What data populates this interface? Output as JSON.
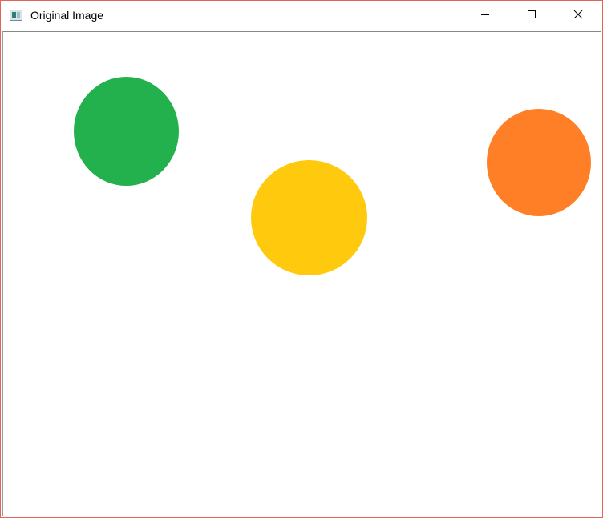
{
  "window": {
    "title": "Original Image",
    "border_color": "#e0645a"
  },
  "titlebar": {
    "icon": "app-window-icon",
    "controls": [
      "minimize-icon",
      "maximize-icon",
      "close-icon"
    ]
  },
  "canvas": {
    "background": "#ffffff",
    "circles": [
      {
        "name": "green-circle",
        "color": "#22b14c"
      },
      {
        "name": "yellow-circle",
        "color": "#ffc90e"
      },
      {
        "name": "orange-circle",
        "color": "#ff7f27"
      }
    ]
  }
}
